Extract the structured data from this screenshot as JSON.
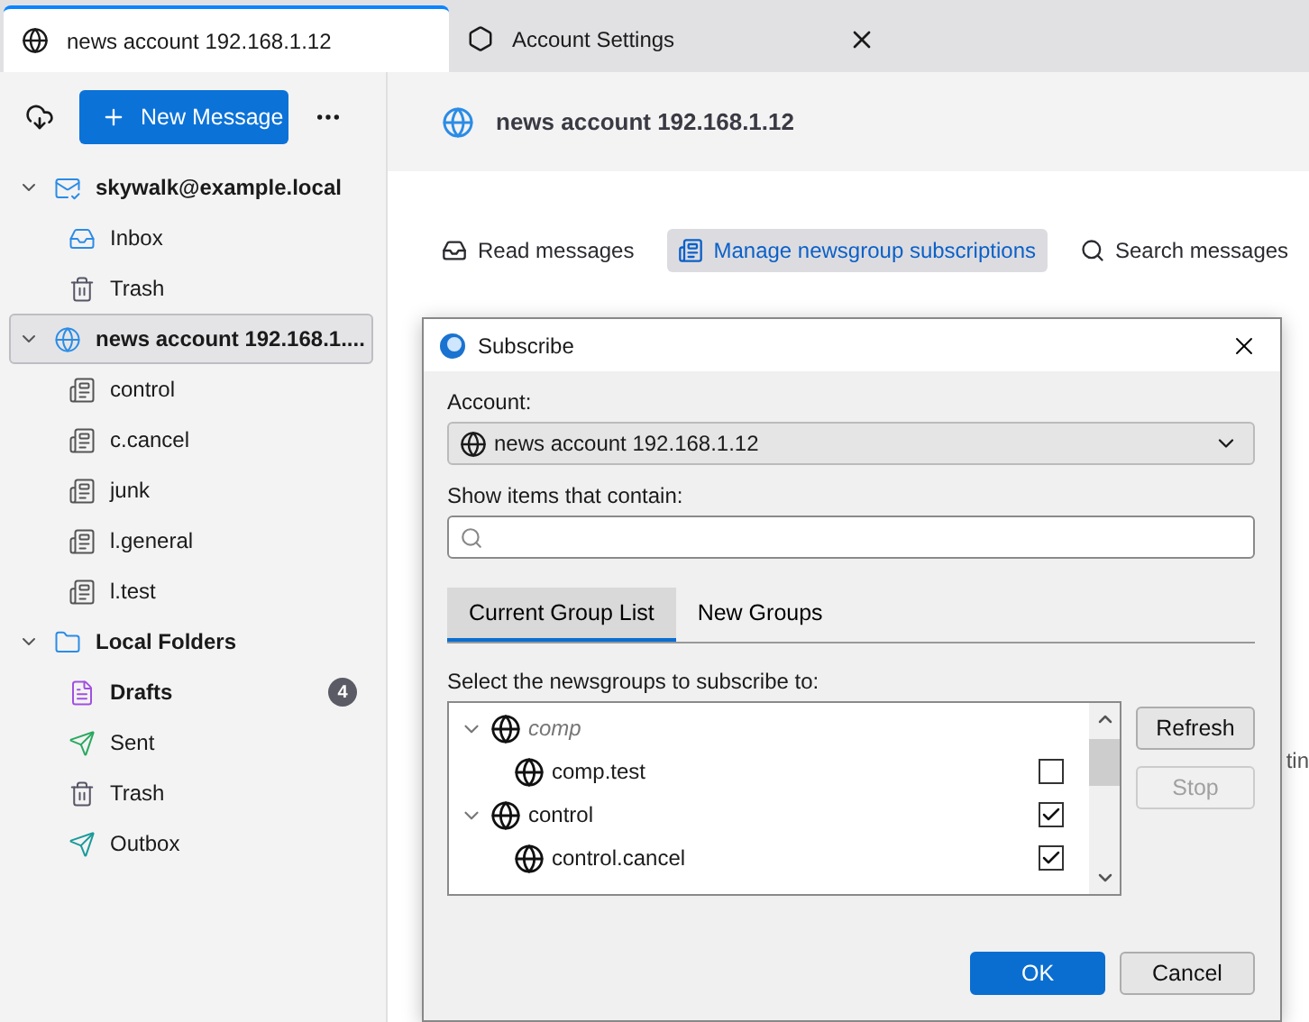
{
  "tabs": [
    {
      "label": "news account 192.168.1.12",
      "kind": "account",
      "selected": true,
      "closable": false
    },
    {
      "label": "Account Settings",
      "kind": "settings",
      "selected": false,
      "closable": true
    }
  ],
  "sidebar": {
    "new_message": "New Message",
    "folders": [
      {
        "label": "skywalk@example.local",
        "kind": "mail-account",
        "expanded": true,
        "selected": false,
        "children": [
          {
            "label": "Inbox",
            "kind": "inbox",
            "selected": false
          },
          {
            "label": "Trash",
            "kind": "trash",
            "selected": false
          }
        ]
      },
      {
        "label": "news account 192.168.1....",
        "kind": "news-account",
        "expanded": true,
        "selected": true,
        "children": [
          {
            "label": "control",
            "kind": "newsgroup",
            "selected": false
          },
          {
            "label": "c.cancel",
            "kind": "newsgroup",
            "selected": false
          },
          {
            "label": "junk",
            "kind": "newsgroup",
            "selected": false
          },
          {
            "label": "l.general",
            "kind": "newsgroup",
            "selected": false
          },
          {
            "label": "l.test",
            "kind": "newsgroup",
            "selected": false
          }
        ]
      },
      {
        "label": "Local Folders",
        "kind": "local",
        "expanded": true,
        "selected": false,
        "children": [
          {
            "label": "Drafts",
            "kind": "drafts",
            "selected": false,
            "unread": "4"
          },
          {
            "label": "Sent",
            "kind": "sent",
            "selected": false
          },
          {
            "label": "Trash",
            "kind": "trash",
            "selected": false
          },
          {
            "label": "Outbox",
            "kind": "outbox",
            "selected": false
          }
        ]
      }
    ]
  },
  "main": {
    "title": "news account 192.168.1.12",
    "actions": [
      {
        "label": "Read messages",
        "kind": "read",
        "selected": false
      },
      {
        "label": "Manage newsgroup subscriptions",
        "kind": "manage",
        "selected": true
      },
      {
        "label": "Search messages",
        "kind": "search",
        "selected": false
      }
    ],
    "fragment": "tin"
  },
  "dialog": {
    "title": "Subscribe",
    "account_label": "Account:",
    "account_value": "news account 192.168.1.12",
    "filter_label": "Show items that contain:",
    "tabs": [
      {
        "label": "Current Group List",
        "selected": true
      },
      {
        "label": "New Groups",
        "selected": false
      }
    ],
    "list_label": "Select the newsgroups to subscribe to:",
    "groups": [
      {
        "name": "comp",
        "kind": "hierarchy",
        "expanded": true,
        "children": [
          {
            "name": "comp.test",
            "kind": "group",
            "checked": false
          }
        ]
      },
      {
        "name": "control",
        "kind": "group",
        "checked": true,
        "expanded": true,
        "children": [
          {
            "name": "control.cancel",
            "kind": "group",
            "checked": true
          }
        ]
      }
    ],
    "side_buttons": [
      {
        "label": "Refresh",
        "disabled": false
      },
      {
        "label": "Stop",
        "disabled": true
      }
    ],
    "buttons": [
      {
        "label": "OK",
        "default": true
      },
      {
        "label": "Cancel",
        "default": false
      }
    ]
  }
}
